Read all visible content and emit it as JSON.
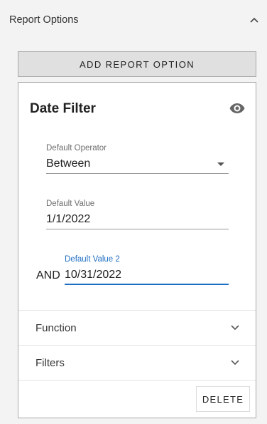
{
  "panel": {
    "title": "Report Options"
  },
  "toolbar": {
    "add_label": "ADD REPORT OPTION"
  },
  "option_card": {
    "title": "Date Filter",
    "fields": {
      "operator": {
        "label": "Default Operator",
        "value": "Between"
      },
      "value1": {
        "label": "Default Value",
        "value": "1/1/2022"
      },
      "value2": {
        "label": "Default Value 2",
        "value": "10/31/2022"
      }
    },
    "conjunction": "AND",
    "sections": {
      "function": "Function",
      "filters": "Filters"
    },
    "delete_label": "DELETE"
  },
  "colors": {
    "accent": "#1f6fc5",
    "background": "#f3f3f3",
    "button_bg": "#e0e0e0"
  },
  "icons": {
    "collapse": "chevron-up-icon",
    "visibility": "eye-icon",
    "dropdown": "caret-down-icon",
    "expand": "chevron-down-icon"
  }
}
